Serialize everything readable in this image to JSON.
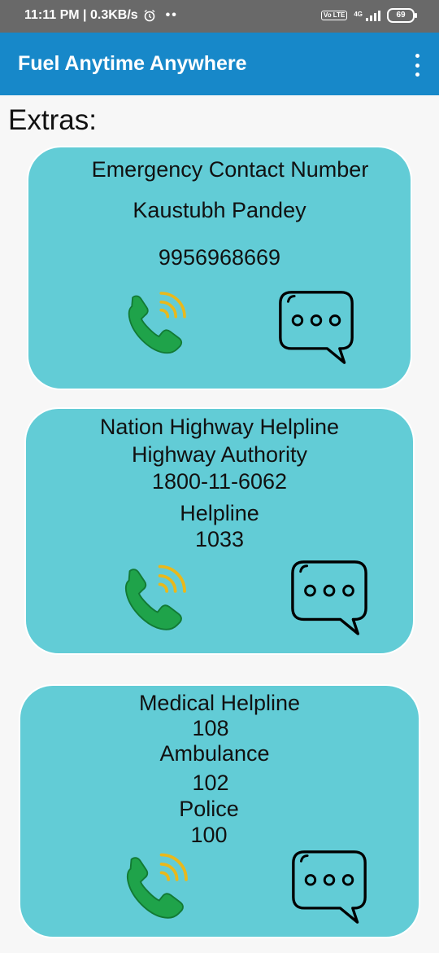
{
  "status_bar": {
    "time_speed": "11:11 PM | 0.3KB/s",
    "network": "4G",
    "volte": "Vo LTE",
    "battery": "69"
  },
  "app_bar": {
    "title": "Fuel Anytime Anywhere",
    "menu_icon": "overflow-menu-icon"
  },
  "page": {
    "section_title": "Extras:"
  },
  "cards": [
    {
      "lines": [
        "Emergency Contact Number",
        "Kaustubh Pandey",
        "9956968669"
      ],
      "call_icon": "phone-call-icon",
      "message_icon": "chat-bubble-icon"
    },
    {
      "lines": [
        "Nation Highway Helpline",
        "Highway Authority",
        "1800-11-6062",
        "Helpline",
        "1033"
      ],
      "call_icon": "phone-call-icon",
      "message_icon": "chat-bubble-icon"
    },
    {
      "lines": [
        "Medical Helpline",
        "108",
        "Ambulance",
        "102",
        "Police",
        "100"
      ],
      "call_icon": "phone-call-icon",
      "message_icon": "chat-bubble-icon"
    }
  ],
  "colors": {
    "app_bar": "#1788c9",
    "card": "#62ccd6",
    "phone": "#1fa34a",
    "waves": "#e9b81b"
  }
}
